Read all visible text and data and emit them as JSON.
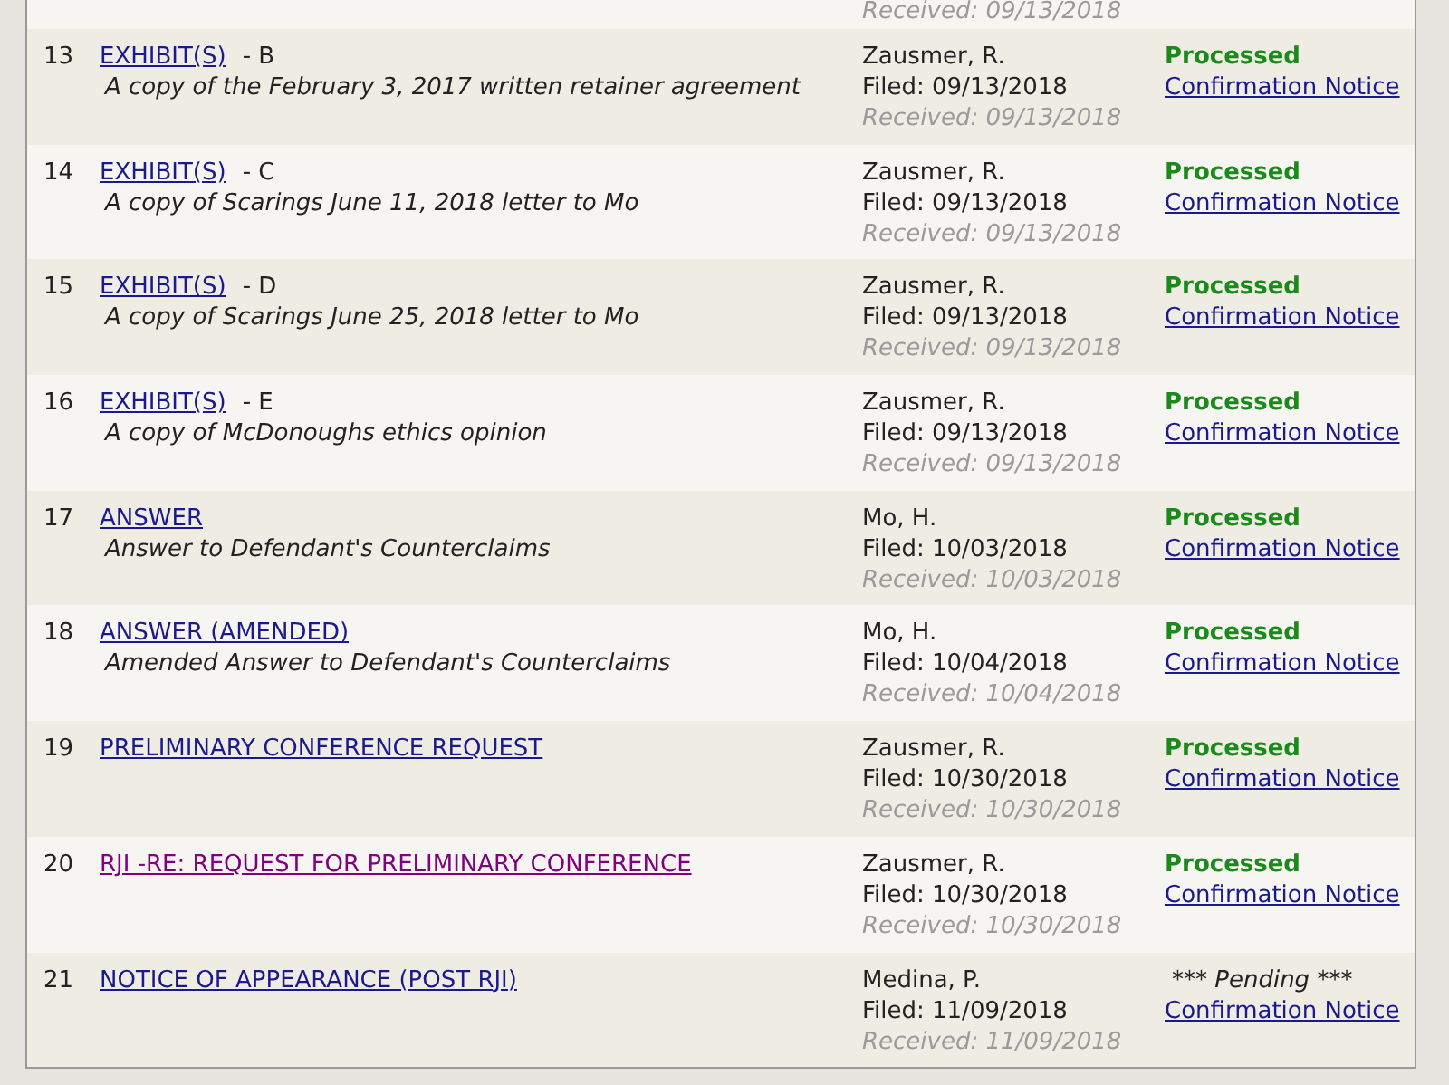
{
  "previous_row": {
    "received": "Received: 09/13/2018"
  },
  "rows": [
    {
      "number": "13",
      "document": "EXHIBIT(S)",
      "suffix": "- B",
      "visited": false,
      "description": "A copy of the February 3, 2017 written retainer agreement",
      "filer": "Zausmer, R.",
      "filed": "Filed: 09/13/2018",
      "received": "Received: 09/13/2018",
      "status": "Processed",
      "kind": "processed",
      "notice": "Confirmation Notice"
    },
    {
      "number": "14",
      "document": "EXHIBIT(S)",
      "suffix": "- C",
      "visited": false,
      "description": "A copy of Scarings June 11, 2018 letter to Mo",
      "filer": "Zausmer, R.",
      "filed": "Filed: 09/13/2018",
      "received": "Received: 09/13/2018",
      "status": "Processed",
      "kind": "processed",
      "notice": "Confirmation Notice"
    },
    {
      "number": "15",
      "document": "EXHIBIT(S)",
      "suffix": "- D",
      "visited": false,
      "description": "A copy of Scarings June 25, 2018 letter to Mo",
      "filer": "Zausmer, R.",
      "filed": "Filed: 09/13/2018",
      "received": "Received: 09/13/2018",
      "status": "Processed",
      "kind": "processed",
      "notice": "Confirmation Notice"
    },
    {
      "number": "16",
      "document": "EXHIBIT(S)",
      "suffix": "- E",
      "visited": false,
      "description": "A copy of McDonoughs ethics opinion",
      "filer": "Zausmer, R.",
      "filed": "Filed: 09/13/2018",
      "received": "Received: 09/13/2018",
      "status": "Processed",
      "kind": "processed",
      "notice": "Confirmation Notice"
    },
    {
      "number": "17",
      "document": "ANSWER",
      "visited": false,
      "description": "Answer to Defendant's Counterclaims",
      "filer": "Mo, H.",
      "filed": "Filed: 10/03/2018",
      "received": "Received: 10/03/2018",
      "status": "Processed",
      "kind": "processed",
      "notice": "Confirmation Notice"
    },
    {
      "number": "18",
      "document": "ANSWER (AMENDED)",
      "visited": false,
      "description": "Amended Answer to Defendant's Counterclaims",
      "filer": "Mo, H.",
      "filed": "Filed: 10/04/2018",
      "received": "Received: 10/04/2018",
      "status": "Processed",
      "kind": "processed",
      "notice": "Confirmation Notice"
    },
    {
      "number": "19",
      "document": "PRELIMINARY CONFERENCE REQUEST",
      "visited": false,
      "filer": "Zausmer, R.",
      "filed": "Filed: 10/30/2018",
      "received": "Received: 10/30/2018",
      "status": "Processed",
      "kind": "processed",
      "notice": "Confirmation Notice"
    },
    {
      "number": "20",
      "document": "RJI -RE: REQUEST FOR PRELIMINARY CONFERENCE",
      "visited": true,
      "filer": "Zausmer, R.",
      "filed": "Filed: 10/30/2018",
      "received": "Received: 10/30/2018",
      "status": "Processed",
      "kind": "processed",
      "notice": "Confirmation Notice"
    },
    {
      "number": "21",
      "document": "NOTICE OF APPEARANCE (POST RJI)",
      "visited": false,
      "filer": "Medina, P.",
      "filed": "Filed: 11/09/2018",
      "received": "Received: 11/09/2018",
      "status": "*** Pending ***",
      "kind": "pending",
      "notice": "Confirmation Notice"
    }
  ]
}
